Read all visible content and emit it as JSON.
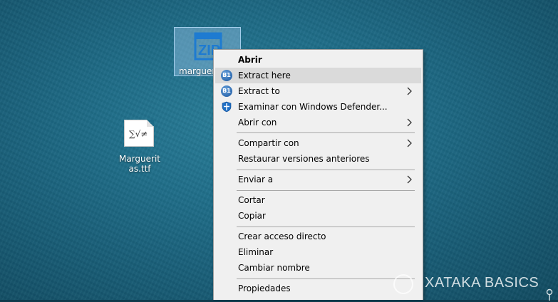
{
  "desktop": {
    "zip_file_label": "marguerit",
    "font_file_label": "Marguerit as.ttf",
    "font_glyph": "∑√≠"
  },
  "context_menu": {
    "items": [
      {
        "label": "Abrir",
        "bold": true
      },
      {
        "label": "Extract here",
        "icon": "b1-icon",
        "highlighted": true
      },
      {
        "label": "Extract to",
        "icon": "b1-icon",
        "submenu": true
      },
      {
        "label": "Examinar con Windows Defender...",
        "icon": "windows-defender-icon"
      },
      {
        "label": "Abrir con",
        "submenu": true
      },
      {
        "label": "Compartir con",
        "submenu": true
      },
      {
        "label": "Restaurar versiones anteriores"
      },
      {
        "label": "Enviar a",
        "submenu": true
      },
      {
        "label": "Cortar"
      },
      {
        "label": "Copiar"
      },
      {
        "label": "Crear acceso directo"
      },
      {
        "label": "Eliminar"
      },
      {
        "label": "Cambiar nombre"
      },
      {
        "label": "Propiedades"
      }
    ],
    "b1_badge": "B1"
  },
  "watermark": {
    "text": "XATAKA BASICS"
  },
  "colors": {
    "desktop_bg": "#1f6d88",
    "menu_bg": "#f0f0f0",
    "highlight": "#dadada",
    "zip_blue": "#1e7bd1"
  }
}
